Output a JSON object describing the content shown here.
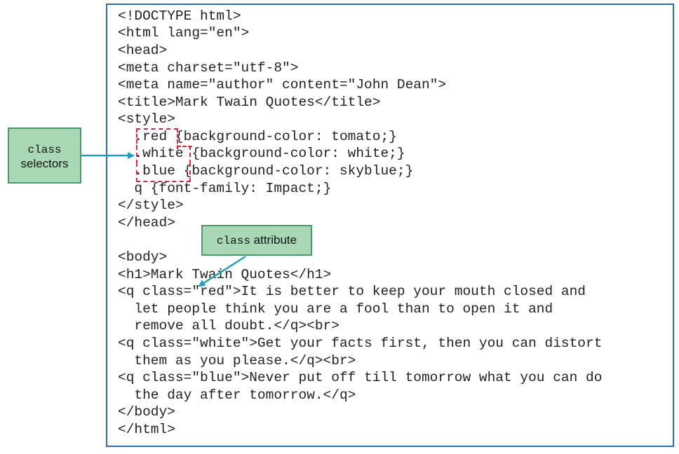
{
  "code": {
    "lines": [
      "<!DOCTYPE html>",
      "<html lang=\"en\">",
      "<head>",
      "<meta charset=\"utf-8\">",
      "<meta name=\"author\" content=\"John Dean\">",
      "<title>Mark Twain Quotes</title>",
      "<style>",
      "  .red {background-color: tomato;}",
      "  .white {background-color: white;}",
      "  .blue {background-color: skyblue;}",
      "  q {font-family: Impact;}",
      "</style>",
      "</head>",
      "",
      "<body>",
      "<h1>Mark Twain Quotes</h1>",
      "<q class=\"red\">It is better to keep your mouth closed and",
      "  let people think you are a fool than to open it and",
      "  remove all doubt.</q><br>",
      "<q class=\"white\">Get your facts first, then you can distort",
      "  them as you please.</q><br>",
      "<q class=\"blue\">Never put off till tomorrow what you can do",
      "  the day after tomorrow.</q>",
      "</body>",
      "</html>"
    ]
  },
  "callouts": {
    "class_selectors": {
      "mono": "class",
      "text": "selectors"
    },
    "class_attribute": {
      "mono": "class",
      "text": " attribute"
    }
  },
  "colors": {
    "frame_border": "#2a6ebb",
    "callout_fill": "#a8d8b4",
    "callout_border": "#4a9a6a",
    "dashed_highlight": "#e0283a",
    "arrow": "#1e9ec4"
  }
}
